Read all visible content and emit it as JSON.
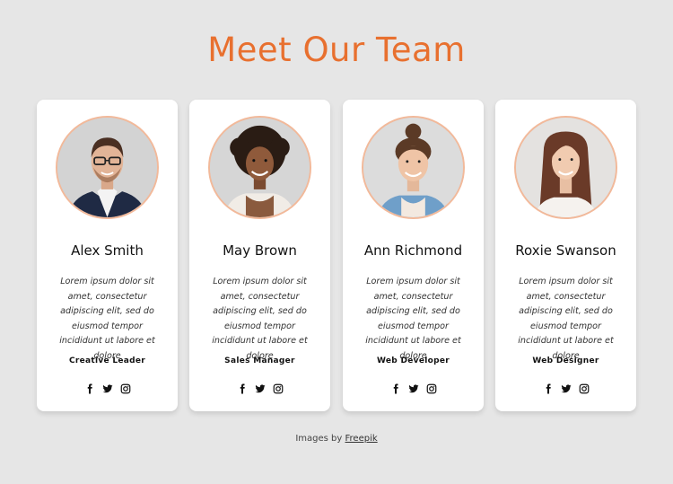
{
  "page": {
    "title": "Meet Our Team",
    "accent_color": "#e8702f",
    "avatar_border_color": "#f2b99a"
  },
  "team": [
    {
      "name": "Alex Smith",
      "description": "Lorem ipsum dolor sit amet, consectetur adipiscing elit, sed do eiusmod tempor incididunt ut labore et dolore",
      "role": "Creative Leader",
      "photo": "man-with-glasses-in-blazer"
    },
    {
      "name": "May Brown",
      "description": "Lorem ipsum dolor sit amet, consectetur adipiscing elit, sed do eiusmod tempor incididunt ut labore et dolore",
      "role": "Sales Manager",
      "photo": "woman-with-curly-hair"
    },
    {
      "name": "Ann Richmond",
      "description": "Lorem ipsum dolor sit amet, consectetur adipiscing elit, sed do eiusmod tempor incididunt ut labore et dolore",
      "role": "Web Developer",
      "photo": "woman-with-hair-bun-in-denim"
    },
    {
      "name": "Roxie Swanson",
      "description": "Lorem ipsum dolor sit amet, consectetur adipiscing elit, sed do eiusmod tempor incididunt ut labore et dolore",
      "role": "Web Designer",
      "photo": "woman-with-long-brown-hair"
    }
  ],
  "social_icons": [
    "facebook-icon",
    "twitter-icon",
    "instagram-icon"
  ],
  "credit": {
    "prefix": "Images by",
    "link": "Freepik"
  }
}
